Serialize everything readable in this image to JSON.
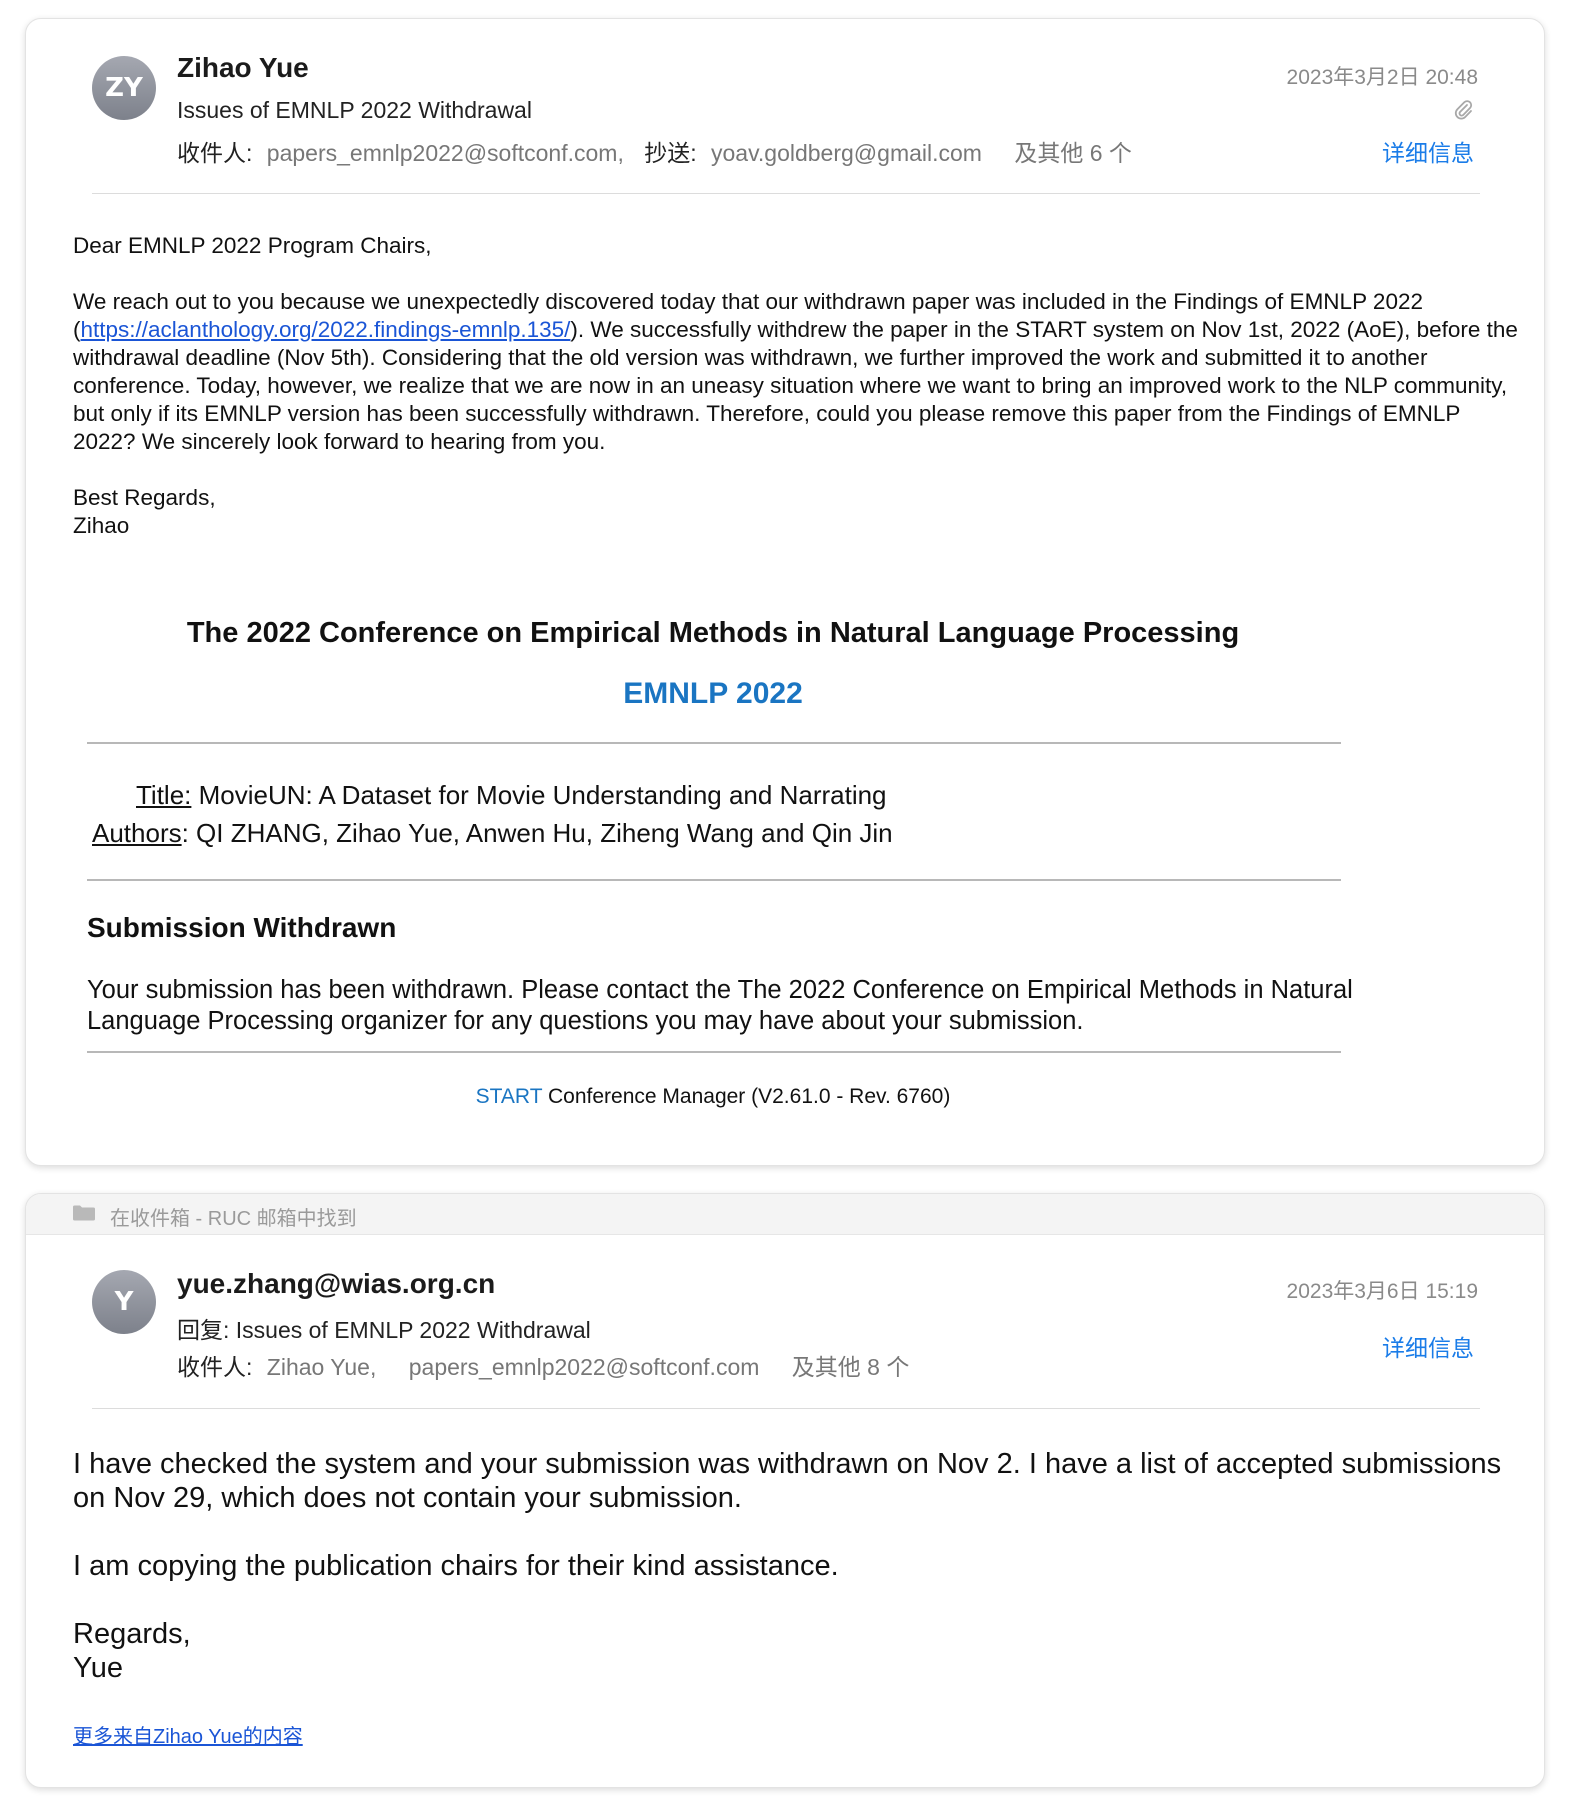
{
  "message1": {
    "avatar_initials": "ZY",
    "sender": "Zihao Yue",
    "subject": "Issues of EMNLP 2022 Withdrawal",
    "to_label": "收件人:",
    "to_address": "papers_emnlp2022@softconf.com,",
    "cc_label": "抄送:",
    "cc_address": "yoav.goldberg@gmail.com",
    "others": "及其他 6 个",
    "date": "2023年3月2日 20:48",
    "details": "详细信息",
    "attachment_icon": "paperclip-icon",
    "greeting": "Dear EMNLP 2022 Program Chairs,",
    "para_a": "We reach out to you because we unexpectedly discovered today that our withdrawn paper was included in the Findings of EMNLP 2022 (",
    "link": "https://aclanthology.org/2022.findings-emnlp.135/",
    "para_b": "). We successfully withdrew the paper in the START system on Nov 1st, 2022 (AoE), before the withdrawal deadline (Nov 5th). Considering that the old version was withdrawn, we further improved the work and submitted it to another conference. Today, however, we realize that we are now in an uneasy situation where we want to bring an improved work to the NLP community, but only if its EMNLP version has been successfully withdrawn. Therefore, could you please remove this paper from the Findings of EMNLP 2022? We sincerely look forward to hearing from you.",
    "signoff": "Best Regards,",
    "signature": "Zihao",
    "embed": {
      "conference": "The 2022 Conference on Empirical Methods in Natural Language Processing",
      "acronym": "EMNLP 2022",
      "title_label": "Title:",
      "title_value": " MovieUN: A Dataset for Movie Understanding and Narrating",
      "authors_label": "Authors",
      "authors_value": ": QI ZHANG, Zihao Yue, Anwen Hu, Ziheng Wang and Qin Jin",
      "status_heading": "Submission Withdrawn",
      "status_text": "Your submission has been withdrawn. Please contact the The 2022 Conference on Empirical Methods in Natural Language Processing organizer for any questions you may have about your submission.",
      "footer_start": "START",
      "footer_rest": " Conference Manager (V2.61.0 - Rev. 6760)"
    }
  },
  "found_bar": {
    "icon": "folder-icon",
    "text": "在收件箱 - RUC 邮箱中找到"
  },
  "message2": {
    "avatar_initials": "Y",
    "sender": "yue.zhang@wias.org.cn",
    "subject": "回复:  Issues of EMNLP 2022 Withdrawal",
    "to_label": "收件人:",
    "to_address_1": "Zihao Yue,",
    "to_address_2": "papers_emnlp2022@softconf.com",
    "others": "及其他 8 个",
    "date": "2023年3月6日 15:19",
    "details": "详细信息",
    "para1": "I have checked the system and your submission was withdrawn on Nov 2. I have a list of accepted submissions on Nov 29, which does not contain your submission.",
    "para2": "I am copying the publication chairs for their kind assistance.",
    "signoff": "Regards,",
    "signature": "Yue",
    "more_link": "更多来自Zihao Yue的内容"
  }
}
